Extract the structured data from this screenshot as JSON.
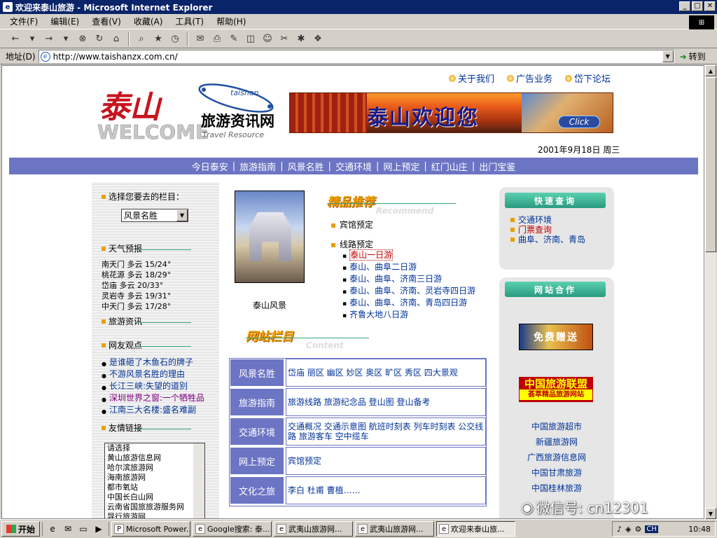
{
  "window": {
    "title": "欢迎来泰山旅游 - Microsoft Internet Explorer",
    "min": "_",
    "max": "□",
    "close": "✕"
  },
  "menu": [
    "文件(F)",
    "编辑(E)",
    "查看(V)",
    "收藏(A)",
    "工具(T)",
    "帮助(H)"
  ],
  "address": {
    "label": "地址(D)",
    "url": "http://www.taishanzx.com.cn/",
    "go": "转到"
  },
  "page": {
    "toplinks": [
      "关于我们",
      "广告业务",
      "岱下论坛"
    ],
    "logo": {
      "main": "泰山",
      "welcome": "WELCOME",
      "brand": "taishan",
      "cn": "旅游资讯网",
      "en": "Travel Resource"
    },
    "banner": {
      "text": "泰山欢迎您",
      "click": "Click"
    },
    "date": "2001年9月18日  周三",
    "nav": [
      "今日泰安",
      "旅游指南",
      "风景名胜",
      "交通环境",
      "网上预定",
      "红门山庄",
      "出门宝鉴"
    ],
    "left": {
      "select_title": "选择您要去的栏目：",
      "select_value": "风景名胜",
      "weather_title": "天气预报",
      "weather": [
        "南天门  多云  15/24°",
        "桃花源  多云  18/29°",
        "岱庙  多云  20/33°",
        "灵岩寺  多云  19/31°",
        "中天门  多云  17/28°"
      ],
      "info_title": "旅游资讯",
      "views_title": "网友观点",
      "views": [
        "是谁砸了木鱼石的牌子",
        "不游风景名胜的理由",
        "长江三峡:失望的道别",
        "深圳世界之窗:一个牺牲品",
        "江南三大名楼:盛名难副"
      ],
      "links_title": "友情链接",
      "links": [
        "请选择",
        "黄山旅游信息网",
        "哈尔滨旅游网",
        "海南旅游网",
        "都市氧站",
        "中国长白山网",
        "云南省国旅旅游服务网",
        "导行旅游网"
      ]
    },
    "center": {
      "photo_caption": "泰山风景",
      "rec_title": "精品推荐",
      "rec_sub": "Recommend",
      "hotel": "宾馆预定",
      "route": "线路预定",
      "routes": [
        "泰山一日游",
        "泰山、曲阜二日游",
        "泰山、曲阜、济南三日游",
        "泰山、曲阜、济南、灵岩寺四日游",
        "泰山、曲阜、济南、青岛四日游",
        "齐鲁大地八日游"
      ],
      "col_title": "网站栏目",
      "col_sub": "Content",
      "rows": [
        {
          "label": "风景名胜",
          "value": "岱庙 丽区 幽区 妙区  奥区 旷区  秀区  四大景观"
        },
        {
          "label": "旅游指南",
          "value": "旅游线路 旅游纪念品  登山图  登山备考"
        },
        {
          "label": "交通环境",
          "value": "交通概况 交通示意图 航班时刻表 列车时刻表 公交线路 旅游客车 空中缆车"
        },
        {
          "label": "网上预定",
          "value": "宾馆预定"
        },
        {
          "label": "文化之旅",
          "value": "李白 杜甫 曹植……"
        }
      ]
    },
    "right": {
      "quick_title": "快速查询",
      "quick": [
        "交通环境",
        "门票查询",
        "曲阜、济南、青岛"
      ],
      "coop_title": "网站合作",
      "ad1": "免费赠送",
      "ad2": "中国旅游联盟",
      "ad2_sub": "荟萃精品旅游网站",
      "links": [
        "中国旅游超市",
        "新疆旅游网",
        "广西旅游信息网",
        "中国甘肃旅游",
        "中国桂林旅游"
      ]
    }
  },
  "taskbar": {
    "start": "开始",
    "tasks": [
      "Microsoft Power...",
      "Google搜索: 泰...",
      "武夷山旅游网...",
      "武夷山旅游网...",
      "欢迎来泰山旅..."
    ],
    "lang": "CH",
    "clock": "10:48"
  },
  "watermark": "微信号: cn12301"
}
